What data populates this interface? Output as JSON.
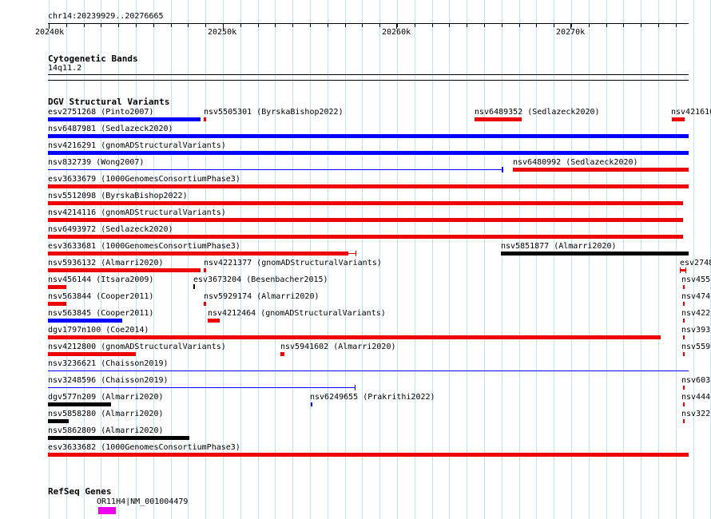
{
  "ruler": {
    "position": "chr14:20239929..20276665",
    "ticks": [
      "20240k",
      "20250k",
      "20260k",
      "20270k"
    ]
  },
  "tracks": {
    "cytoband": {
      "title": "Cytogenetic Bands",
      "band": "14q11.2"
    },
    "dgv": {
      "title": "DGV Structural Variants",
      "labels": [
        "esv2751268 (Pinto2007)",
        "nsv5505301 (ByrskaBishop2022)",
        "nsv6489352 (Sedlazeck2020)",
        "nsv421610",
        "nsv6487981 (Sedlazeck2020)",
        "nsv4216291 (gnomADStructuralVariants)",
        "nsv832739 (Wong2007)",
        "nsv6480992 (Sedlazeck2020)",
        "esv3633679 (1000GenomesConsortiumPhase3)",
        "nsv5512098 (ByrskaBishop2022)",
        "nsv4214116 (gnomADStructuralVariants)",
        "nsv6493972 (Sedlazeck2020)",
        "esv3633681 (1000GenomesConsortiumPhase3)",
        "nsv5851877 (Almarri2020)",
        "nsv5936132 (Almarri2020)",
        "nsv4221377 (gnomADStructuralVariants)",
        "esv2748",
        "nsv456144 (Itsara2009)",
        "esv3673204 (Besenbacher2015)",
        "nsv455",
        "nsv563844 (Cooper2011)",
        "nsv5929174 (Almarri2020)",
        "nsv474",
        "nsv563845 (Cooper2011)",
        "nsv4212464 (gnomADStructuralVariants)",
        "nsv422",
        "dgv1797n100 (Coe2014)",
        "nsv393",
        "nsv4212800 (gnomADStructuralVariants)",
        "nsv5941602 (Almarri2020)",
        "nsv559",
        "nsv3236621 (Chaisson2019)",
        "nsv3248596 (Chaisson2019)",
        "nsv603",
        "dgv577n209 (Almarri2020)",
        "nsv6249655 (Prakrithi2022)",
        "nsv444",
        "nsv5858280 (Almarri2020)",
        "nsv322",
        "nsv5862809 (Almarri2020)",
        "esv3633682 (1000GenomesConsortiumPhase3)"
      ]
    },
    "refseq": {
      "title": "RefSeq Genes",
      "gene_label": "OR11H4|NM_001004479"
    }
  },
  "colors": {
    "gain": "#0000ff",
    "loss": "#ee0000",
    "complex": "#000000",
    "gene": "#ee00ee",
    "grid": "#bfe4f4"
  }
}
